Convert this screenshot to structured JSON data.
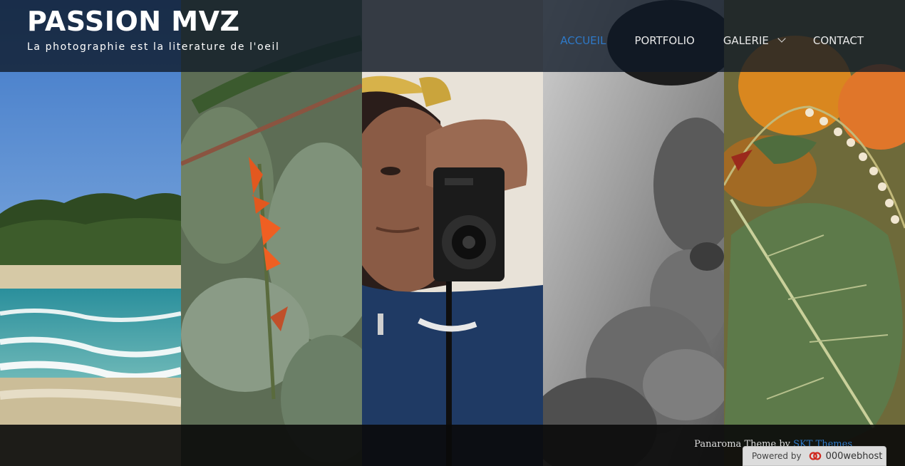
{
  "site": {
    "title": "PASSION MVZ",
    "tagline": "La photographie est la literature de l'oeil"
  },
  "nav": {
    "items": [
      {
        "label": "ACCUEIL",
        "active": true
      },
      {
        "label": "PORTFOLIO"
      },
      {
        "label": "GALERIE",
        "has_dropdown": true
      },
      {
        "label": "CONTACT"
      }
    ]
  },
  "footer": {
    "credit_prefix": "Panaroma Theme by",
    "credit_link": "SKT Themes"
  },
  "badge": {
    "label": "Powered by",
    "brand": "000webhost"
  },
  "gallery": [
    {
      "subject": "beach-photo"
    },
    {
      "subject": "red-flower-photo"
    },
    {
      "subject": "selfie-camera-photo"
    },
    {
      "subject": "teddy-bear-photo"
    },
    {
      "subject": "leaf-flower-photo"
    }
  ],
  "colors": {
    "accent": "#2e79c8"
  }
}
